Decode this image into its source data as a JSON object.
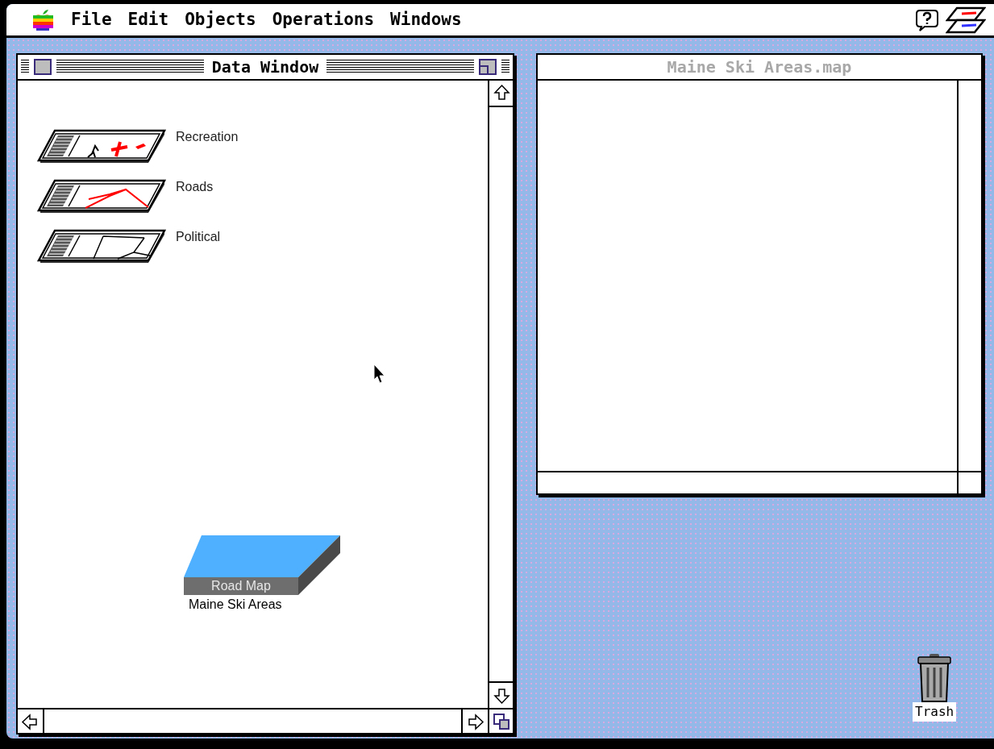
{
  "menu_bar": {
    "items": [
      "File",
      "Edit",
      "Objects",
      "Operations",
      "Windows"
    ]
  },
  "data_window": {
    "title": "Data Window",
    "active": true,
    "layers": [
      {
        "name": "Recreation",
        "kind": "recreation"
      },
      {
        "name": "Roads",
        "kind": "roads"
      },
      {
        "name": "Political",
        "kind": "political"
      }
    ],
    "document": {
      "label": "Road Map",
      "name": "Maine Ski Areas"
    }
  },
  "map_window": {
    "title": "Maine Ski Areas.map",
    "active": false
  },
  "trash": {
    "label": "Trash"
  }
}
